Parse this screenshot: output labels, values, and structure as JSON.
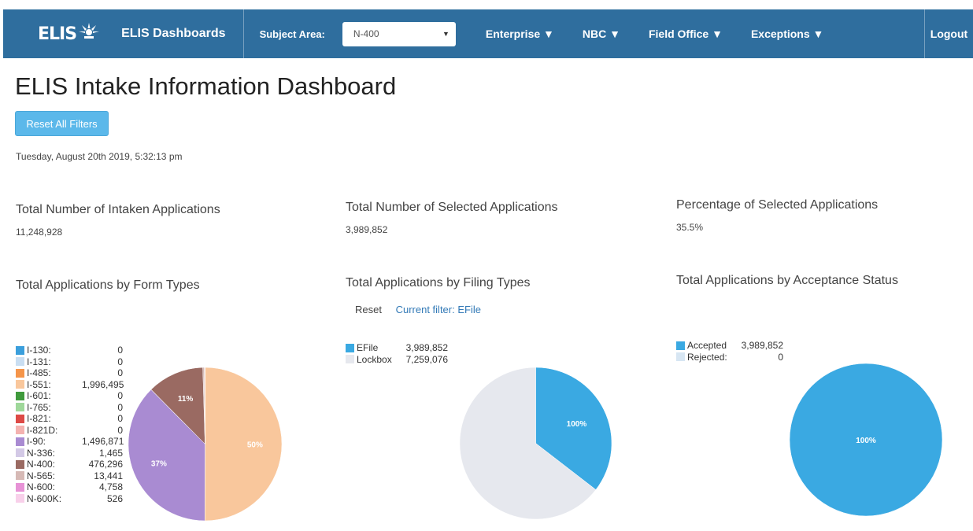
{
  "navbar": {
    "logo_text": "ELIS",
    "title": "ELIS Dashboards",
    "subject_area_label": "Subject Area:",
    "subject_area_value": "N-400",
    "menus": [
      "Enterprise ▼",
      "NBC ▼",
      "Field Office ▼",
      "Exceptions ▼"
    ],
    "logout": "Logout"
  },
  "page": {
    "title": "ELIS Intake Information Dashboard",
    "reset_all_label": "Reset All Filters",
    "datetime": "Tuesday, August 20th 2019, 5:32:13 pm"
  },
  "kpis": [
    {
      "label": "Total Number of Intaken Applications",
      "value": "11,248,928"
    },
    {
      "label": "Total Number of Selected Applications",
      "value": "3,989,852"
    },
    {
      "label": "Percentage of Selected Applications",
      "value": "35.5%"
    }
  ],
  "form_types": {
    "title": "Total Applications by Form Types"
  },
  "filing_types": {
    "title": "Total Applications by Filing Types",
    "reset_label": "Reset",
    "current_filter_label": "Current filter:",
    "current_filter_value": "EFile"
  },
  "acceptance": {
    "title": "Total Applications by Acceptance Status"
  },
  "chart_data": [
    {
      "type": "pie",
      "title": "Total Applications by Form Types",
      "categories": [
        "I-130:",
        "I-131:",
        "I-485:",
        "I-551:",
        "I-601:",
        "I-765:",
        "I-821:",
        "I-821D:",
        "I-90:",
        "N-336:",
        "N-400:",
        "N-565:",
        "N-600:",
        "N-600K:"
      ],
      "values": [
        0,
        0,
        0,
        1996495,
        0,
        0,
        0,
        0,
        1496871,
        1465,
        476296,
        13441,
        4758,
        526
      ],
      "value_labels": [
        "0",
        "0",
        "0",
        "1,996,495",
        "0",
        "0",
        "0",
        "0",
        "1,496,871",
        "1,465",
        "476,296",
        "13,441",
        "4,758",
        "526"
      ],
      "colors": [
        "#3b9fdc",
        "#c9def2",
        "#f5954a",
        "#f9c79c",
        "#3f9a3c",
        "#9fd89a",
        "#dd4a46",
        "#f4b2b0",
        "#a98bd2",
        "#d3c9e6",
        "#9a6a62",
        "#d6b9b5",
        "#e792d6",
        "#f8d0ea"
      ],
      "slice_labels": [
        "50%",
        "37%",
        "11%"
      ]
    },
    {
      "type": "pie",
      "title": "Total Applications by Filing Types",
      "categories": [
        "EFile",
        "Lockbox"
      ],
      "values": [
        3989852,
        7259076
      ],
      "value_labels": [
        "3,989,852",
        "7,259,076"
      ],
      "colors": [
        "#3aa9e2",
        "#e6e8ee"
      ],
      "slice_labels": [
        "100%"
      ]
    },
    {
      "type": "pie",
      "title": "Total Applications by Acceptance Status",
      "categories": [
        "Accepted",
        "Rejected:"
      ],
      "values": [
        3989852,
        0
      ],
      "value_labels": [
        "3,989,852",
        "0"
      ],
      "colors": [
        "#3aa9e2",
        "#d7e6f3"
      ],
      "slice_labels": [
        "100%"
      ]
    }
  ]
}
